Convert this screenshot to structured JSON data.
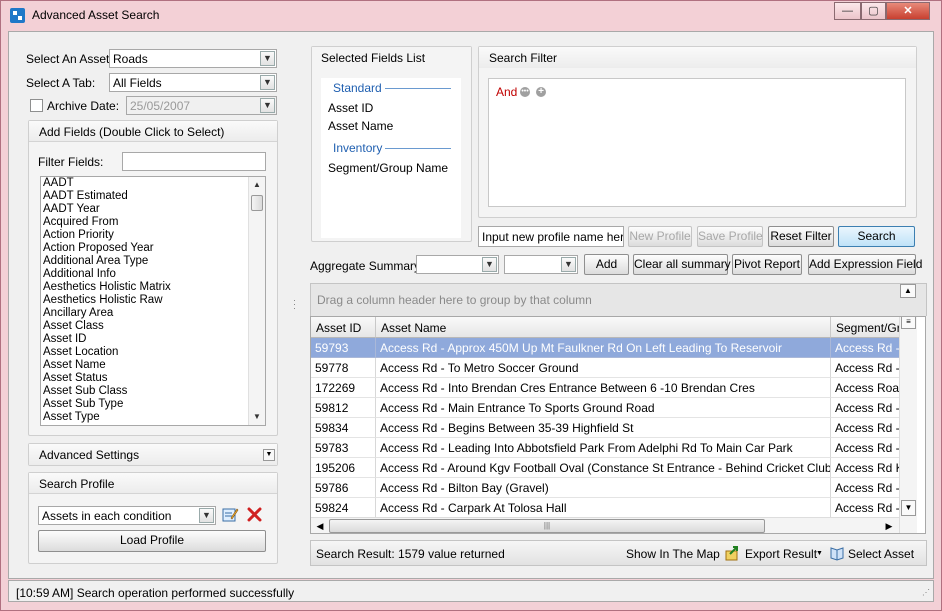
{
  "window": {
    "title": "Advanced Asset Search",
    "min_glyph": "—",
    "max_glyph": "▢",
    "close_glyph": "✕"
  },
  "left": {
    "select_asset_label": "Select An Asset:",
    "select_asset_value": "Roads",
    "select_tab_label": "Select A Tab:",
    "select_tab_value": "All Fields",
    "archive_date_label": "Archive Date:",
    "archive_date_value": "25/05/2007",
    "archive_checked": false,
    "add_fields_title": "Add Fields (Double Click to Select)",
    "filter_fields_label": "Filter Fields:",
    "filter_fields_value": "",
    "fields": [
      "AADT",
      "AADT Estimated",
      "AADT Year",
      "Acquired From",
      "Action Priority",
      "Action Proposed Year",
      "Additional Area Type",
      "Additional Info",
      "Aesthetics Holistic Matrix",
      "Aesthetics Holistic Raw",
      "Ancillary Area",
      "Asset Class",
      "Asset ID",
      "Asset Location",
      "Asset Name",
      "Asset Status",
      "Asset Sub Class",
      "Asset Sub Type",
      "Asset Type"
    ],
    "advanced_settings_title": "Advanced Settings",
    "search_profile_title": "Search Profile",
    "profile_value": "Assets in each condition",
    "load_profile_label": "Load Profile"
  },
  "selected_fields": {
    "title": "Selected Fields List",
    "groups": [
      {
        "name": "Standard",
        "items": [
          "Asset ID",
          "Asset Name"
        ]
      },
      {
        "name": "Inventory",
        "items": [
          "Segment/Group Name"
        ]
      }
    ]
  },
  "search_filter": {
    "title": "Search Filter",
    "operator": "And"
  },
  "profile_bar": {
    "profile_name_placeholder": "Input new profile name here.",
    "new_profile_label": "New Profile",
    "save_profile_label": "Save Profile",
    "reset_filter_label": "Reset Filter",
    "search_label": "Search"
  },
  "aggregate": {
    "label": "Aggregate Summary:",
    "add_label": "Add",
    "clear_label": "Clear all summary",
    "pivot_label": "Pivot Report",
    "add_expression_label": "Add Expression Field"
  },
  "grid": {
    "group_hint": "Drag a column header here to group by that column",
    "columns": [
      "Asset ID",
      "Asset Name",
      "Segment/Group Name"
    ],
    "rows": [
      {
        "id": "59793",
        "name": "Access Rd - Approx 450M Up Mt Faulkner Rd On Left Leading To Reservoir",
        "seg": "Access Rd - Approx"
      },
      {
        "id": "59778",
        "name": "Access Rd - To Metro Soccer Ground",
        "seg": "Access Rd - To Metro"
      },
      {
        "id": "172269",
        "name": "Access Rd - Into Brendan Cres Entrance Between 6 -10 Brendan Cres",
        "seg": "Access Road To"
      },
      {
        "id": "59812",
        "name": "Access Rd - Main Entrance To Sports Ground Road",
        "seg": "Access Rd - Main"
      },
      {
        "id": "59834",
        "name": "Access Rd - Begins Between 35-39 Highfield St",
        "seg": "Access Rd - Begins"
      },
      {
        "id": "59783",
        "name": "Access Rd - Leading Into Abbotsfield Park From Adelphi Rd To Main Car Park",
        "seg": "Access Rd - Leading"
      },
      {
        "id": "195206",
        "name": "Access Rd - Around Kgv Football Oval (Constance St Entrance - Behind Cricket Clubhouse)",
        "seg": "Access Rd Kgv"
      },
      {
        "id": "59786",
        "name": "Access Rd - Bilton Bay (Gravel)",
        "seg": "Access Rd - Bilton"
      },
      {
        "id": "59824",
        "name": "Access Rd - Carpark At Tolosa Hall",
        "seg": "Access Rd - Tolosa"
      }
    ],
    "selected_row": 0
  },
  "result_bar": {
    "result_text": "Search Result: 1579 value returned",
    "show_map_label": "Show In The Map",
    "export_label": "Export Result",
    "select_asset_label": "Select Asset"
  },
  "status_text": "[10:59 AM] Search operation performed successfully",
  "colors": {
    "accent": "#1f5fb0",
    "and_operator": "#c00000",
    "selected_row": "#8fa9db",
    "delete": "#d02020"
  }
}
